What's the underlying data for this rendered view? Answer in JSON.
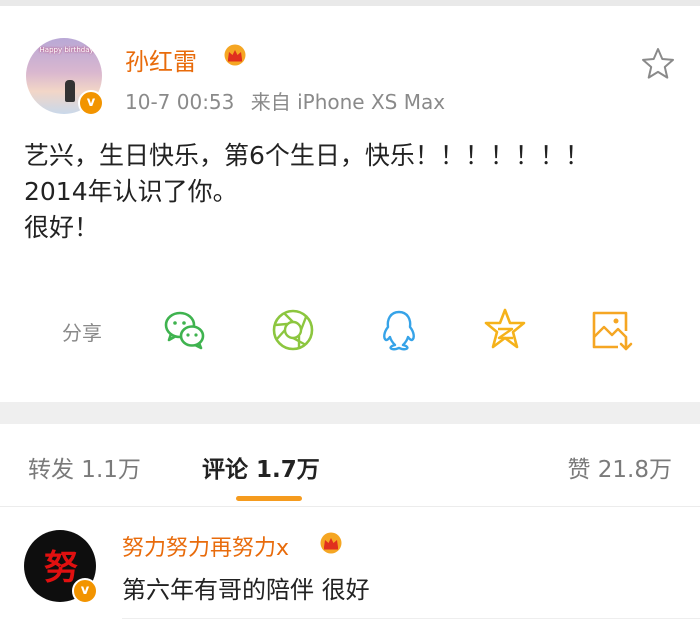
{
  "post": {
    "author": "孙红雷",
    "time": "10-7 00:53",
    "source": "来自 iPhone XS Max",
    "avatar_text": "Happy birthday!",
    "verified": "v",
    "content": [
      "艺兴，生日快乐，第6个生日，快乐！！！！！！！",
      "2014年认识了你。",
      "很好！"
    ]
  },
  "share": {
    "label": "分享",
    "targets": [
      "wechat-icon",
      "moments-icon",
      "qq-icon",
      "qzone-icon",
      "save-image-icon"
    ]
  },
  "tabs": {
    "repost": "转发 1.1万",
    "comments": "评论 1.7万",
    "likes": "赞 21.8万"
  },
  "comment": {
    "author": "努力努力再努力x",
    "text": "第六年有哥的陪伴 很好",
    "verified": "v"
  },
  "colors": {
    "accent": "#e86b0b",
    "tab_underline": "#f59b1e",
    "wechat": "#3fb34f",
    "moments": "#8cc63f",
    "qq": "#36a3e8",
    "qzone": "#f5b21b",
    "save": "#f5a623"
  }
}
